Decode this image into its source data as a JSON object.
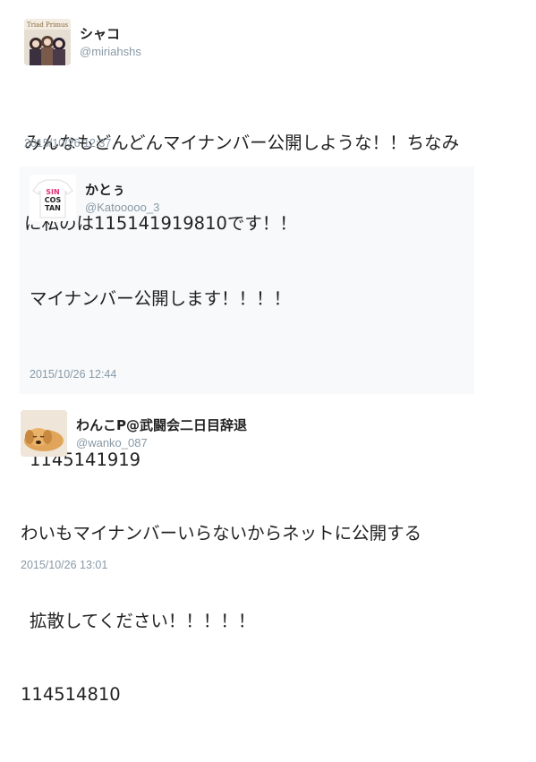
{
  "tweets": [
    {
      "avatar_icon": "trio-anime-avatar-icon",
      "avatar_text": "Triad Primus",
      "name": "シャコ",
      "handle": "@miriahshs",
      "lines": [
        "みんなもどんどんマイナンバー公開しような！！ちなみ",
        "に私のは115141919810です！！"
      ],
      "date": "2015/10/26 12:37"
    },
    {
      "avatar_icon": "sincostan-shirt-avatar-icon",
      "avatar_text": [
        "SIN",
        "COS",
        "TAN"
      ],
      "name": "かとぅ",
      "handle": "@Katooooo_3",
      "lines": [
        "マイナンバー公開します！！！！",
        "",
        "1145141919",
        "",
        "拡散してください！！！！！"
      ],
      "date": "2015/10/26 12:44"
    },
    {
      "avatar_icon": "sleeping-dog-avatar-icon",
      "name": "わんこP@武闘会二日目辞退",
      "handle": "@wanko_087",
      "lines": [
        "わいもマイナンバーいらないからネットに公開する",
        "",
        "114514810"
      ],
      "date": "2015/10/26 13:01"
    }
  ],
  "colors": {
    "text": "#222222",
    "meta": "#8899a6",
    "quote_bg": "#f8f9fa",
    "accent_pink": "#e0307a"
  }
}
